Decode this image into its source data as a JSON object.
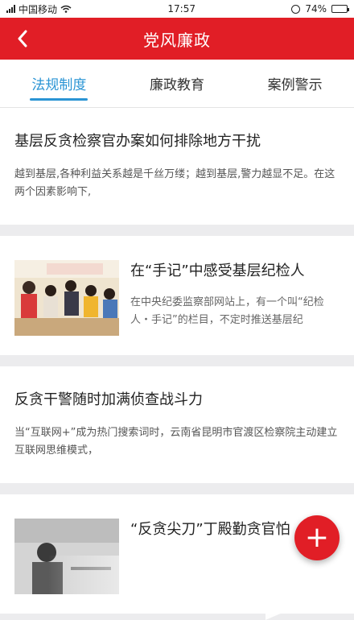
{
  "statusbar": {
    "carrier": "中国移动",
    "time": "17:57",
    "battery": "74%",
    "battery_level": 0.74
  },
  "header": {
    "title": "党风廉政"
  },
  "tabs": [
    {
      "label": "法规制度",
      "active": true
    },
    {
      "label": "廉政教育",
      "active": false
    },
    {
      "label": "案例警示",
      "active": false
    }
  ],
  "feed": [
    {
      "title": "基层反贪检察官办案如何排除地方干扰",
      "summary": "越到基层,各种利益关系越是千丝万缕；越到基层,警力越显不足。在这两个因素影响下,"
    },
    {
      "title": "在“手记”中感受基层纪检人",
      "summary": "在中央纪委监察部网站上，有一个叫“纪检人・手记”的栏目，不定时推送基层纪"
    },
    {
      "title": "反贪干警随时加满侦查战斗力",
      "summary": "当“互联网+”成为热门搜索词时，云南省昆明市官渡区检察院主动建立互联网思维模式，"
    },
    {
      "title": "“反贪尖刀”丁殿勤贪官怕",
      "summary": ""
    }
  ],
  "colors": {
    "brand_red": "#e11e26",
    "tab_active": "#2a94d4"
  },
  "icons": {
    "back": "chevron-left-icon",
    "fab": "plus-icon"
  }
}
